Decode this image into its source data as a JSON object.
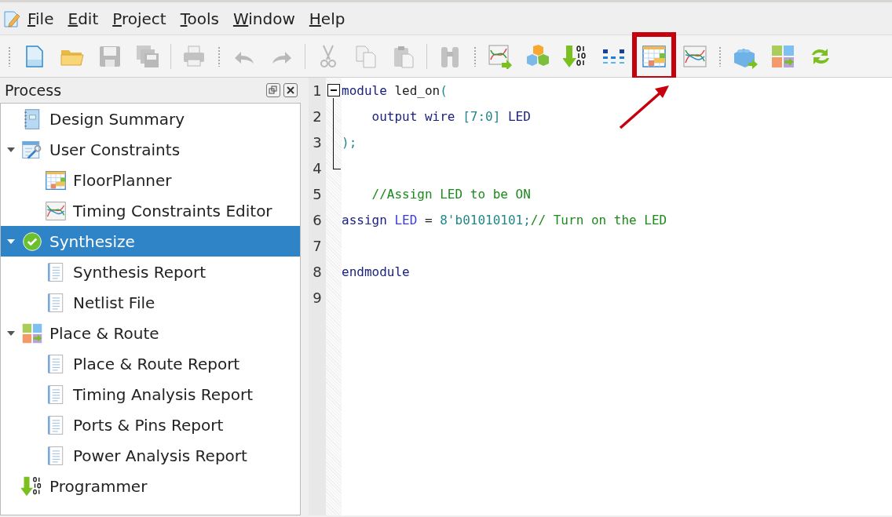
{
  "menu": [
    {
      "label": "File"
    },
    {
      "label": "Edit"
    },
    {
      "label": "Project"
    },
    {
      "label": "Tools"
    },
    {
      "label": "Window"
    },
    {
      "label": "Help"
    }
  ],
  "toolbar": [
    {
      "kind": "grip"
    },
    {
      "kind": "button",
      "disabled": false,
      "highlighted": false
    },
    {
      "kind": "button",
      "disabled": false,
      "highlighted": false
    },
    {
      "kind": "button",
      "disabled": true,
      "highlighted": false
    },
    {
      "kind": "button",
      "disabled": true,
      "highlighted": false
    },
    {
      "kind": "separator"
    },
    {
      "kind": "button",
      "disabled": true,
      "highlighted": false
    },
    {
      "kind": "grip"
    },
    {
      "kind": "button",
      "disabled": true,
      "highlighted": false
    },
    {
      "kind": "button",
      "disabled": true,
      "highlighted": false
    },
    {
      "kind": "separator"
    },
    {
      "kind": "button",
      "disabled": true,
      "highlighted": false
    },
    {
      "kind": "button",
      "disabled": true,
      "highlighted": false
    },
    {
      "kind": "button",
      "disabled": true,
      "highlighted": false
    },
    {
      "kind": "separator"
    },
    {
      "kind": "button",
      "disabled": true,
      "highlighted": false
    },
    {
      "kind": "grip"
    },
    {
      "kind": "button",
      "disabled": false,
      "highlighted": false
    },
    {
      "kind": "button",
      "disabled": false,
      "highlighted": false
    },
    {
      "kind": "button",
      "disabled": false,
      "highlighted": false
    },
    {
      "kind": "button",
      "disabled": false,
      "highlighted": false
    },
    {
      "kind": "button",
      "disabled": false,
      "highlighted": true
    },
    {
      "kind": "button",
      "disabled": false,
      "highlighted": false
    },
    {
      "kind": "grip"
    },
    {
      "kind": "button",
      "disabled": false,
      "highlighted": false
    },
    {
      "kind": "button",
      "disabled": false,
      "highlighted": false
    },
    {
      "kind": "button",
      "disabled": false,
      "highlighted": false
    }
  ],
  "process_panel": {
    "title": "Process",
    "items": [
      {
        "label": "Design Summary",
        "selected": false
      },
      {
        "label": "User Constraints",
        "selected": false,
        "expanded": true,
        "children": [
          {
            "label": "FloorPlanner",
            "selected": false
          },
          {
            "label": "Timing Constraints Editor",
            "selected": false
          }
        ]
      },
      {
        "label": "Synthesize",
        "selected": true,
        "expanded": true,
        "children": [
          {
            "label": "Synthesis Report",
            "selected": false
          },
          {
            "label": "Netlist File",
            "selected": false
          }
        ]
      },
      {
        "label": "Place & Route",
        "selected": false,
        "expanded": true,
        "children": [
          {
            "label": "Place & Route Report",
            "selected": false
          },
          {
            "label": "Timing Analysis Report",
            "selected": false
          },
          {
            "label": "Ports & Pins Report",
            "selected": false
          },
          {
            "label": "Power Analysis Report",
            "selected": false
          }
        ]
      },
      {
        "label": "Programmer",
        "selected": false
      }
    ]
  },
  "editor": {
    "lines": [
      {
        "number": "1",
        "tokens": [
          {
            "kind": "keyword",
            "text": "module"
          },
          {
            "kind": "plain",
            "text": " led_on"
          },
          {
            "kind": "number",
            "text": "("
          }
        ]
      },
      {
        "number": "2",
        "indented": true,
        "tokens": [
          {
            "kind": "keyword",
            "text": "output wire"
          },
          {
            "kind": "number",
            "text": " [7:0]"
          },
          {
            "kind": "keyword",
            "text": " LED"
          }
        ]
      },
      {
        "number": "3",
        "tokens": [
          {
            "kind": "number",
            "text": ");"
          }
        ]
      },
      {
        "number": "4"
      },
      {
        "number": "5",
        "indented": true,
        "tokens": [
          {
            "kind": "comment",
            "text": "//Assign LED to be ON"
          }
        ]
      },
      {
        "number": "6",
        "tokens": [
          {
            "kind": "keyword",
            "text": "assign"
          },
          {
            "kind": "ident",
            "text": " LED"
          },
          {
            "kind": "plain",
            "text": " = "
          },
          {
            "kind": "number",
            "text": "8'b01010101;"
          },
          {
            "kind": "comment",
            "text": "// Turn on the LED"
          }
        ]
      },
      {
        "number": "7"
      },
      {
        "number": "8",
        "tokens": [
          {
            "kind": "keyword",
            "text": "endmodule"
          }
        ]
      },
      {
        "number": "9"
      }
    ],
    "fold": {
      "expanded": true
    }
  },
  "annotation": {
    "arrow": true
  }
}
